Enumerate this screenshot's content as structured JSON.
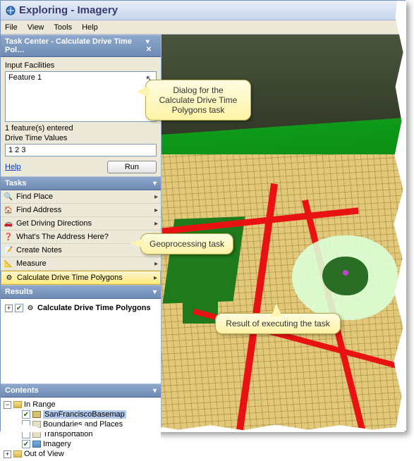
{
  "window": {
    "title": "Exploring - Imagery"
  },
  "menubar": {
    "file": "File",
    "view": "View",
    "tools": "Tools",
    "help": "Help"
  },
  "taskCenter": {
    "header": "Task Center - Calculate Drive Time Pol…",
    "inputFacilitiesLabel": "Input Facilities",
    "facilityEntry": "Feature 1",
    "featuresEnteredText": "1 feature(s) entered",
    "driveTimeLabel": "Drive Time Values",
    "driveTimeValue": "1 2 3",
    "helpLinkText": "Help",
    "runButton": "Run"
  },
  "tasksPanel": {
    "header": "Tasks",
    "items": [
      {
        "icon": "🔍",
        "label": "Find Place"
      },
      {
        "icon": "🏠",
        "label": "Find Address"
      },
      {
        "icon": "🚗",
        "label": "Get Driving Directions"
      },
      {
        "icon": "❓",
        "label": "What's The Address Here?"
      },
      {
        "icon": "📝",
        "label": "Create Notes"
      },
      {
        "icon": "📐",
        "label": "Measure"
      },
      {
        "icon": "⚙",
        "label": "Calculate Drive Time Polygons"
      }
    ]
  },
  "resultsPanel": {
    "header": "Results",
    "rootLabel": "Calculate Drive Time Polygons"
  },
  "contentsPanel": {
    "header": "Contents",
    "inRange": "In Range",
    "layers": [
      {
        "checked": true,
        "label": "SanFranciscoBasemap",
        "selected": true
      },
      {
        "checked": false,
        "label": "Boundaries and Places",
        "selected": false
      },
      {
        "checked": false,
        "label": "Transportation",
        "selected": false
      },
      {
        "checked": true,
        "label": "Imagery",
        "selected": false
      }
    ],
    "outOfView": "Out of View"
  },
  "callouts": {
    "dialog": "Dialog for the Calculate Drive Time Polygons task",
    "task": "Geoprocessing task",
    "result": "Result of executing the task"
  }
}
